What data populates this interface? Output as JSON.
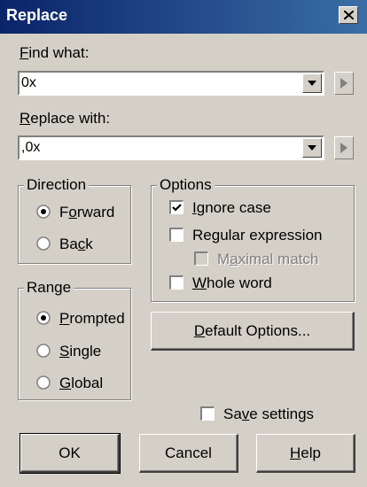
{
  "dialog": {
    "title": "Replace",
    "find_label": "Find what:",
    "find_value": "0x",
    "replace_label": "Replace with:",
    "replace_value": ",0x",
    "direction": {
      "legend": "Direction",
      "forward": "Forward",
      "back": "Back",
      "selected": "forward"
    },
    "options": {
      "legend": "Options",
      "ignore_case": {
        "label": "Ignore case",
        "checked": true
      },
      "regular_expression": {
        "label": "Regular expression",
        "checked": false
      },
      "maximal_match": {
        "label": "Maximal match",
        "checked": false,
        "enabled": false
      },
      "whole_word": {
        "label": "Whole word",
        "checked": false
      }
    },
    "range": {
      "legend": "Range",
      "prompted": "Prompted",
      "single": "Single",
      "global": "Global",
      "selected": "prompted"
    },
    "default_options_button": "Default Options...",
    "save_settings": {
      "label": "Save settings",
      "checked": false
    },
    "ok_button": "OK",
    "cancel_button": "Cancel",
    "help_button": "Help",
    "icons": [
      "close-icon",
      "dropdown-arrow-icon",
      "right-arrow-icon",
      "checkmark-icon"
    ]
  }
}
